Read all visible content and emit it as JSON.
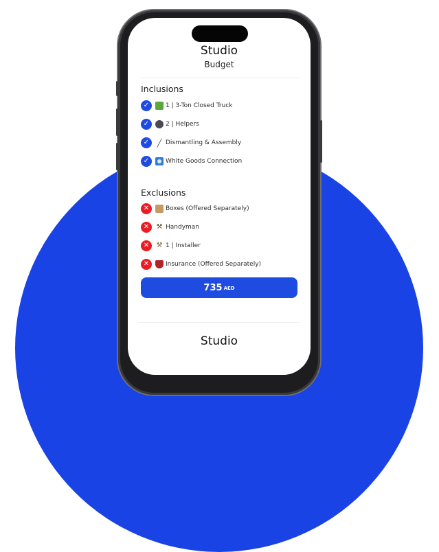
{
  "card": {
    "title": "Studio",
    "subtitle": "Budget",
    "inclusions_heading": "Inclusions",
    "inclusions": [
      {
        "label": "1 | 3-Ton Closed Truck",
        "icon": "truck-icon"
      },
      {
        "label": "2 | Helpers",
        "icon": "helpers-icon"
      },
      {
        "label": "Dismantling & Assembly",
        "icon": "screwdriver-icon"
      },
      {
        "label": "White Goods Connection",
        "icon": "washing-machine-icon"
      }
    ],
    "exclusions_heading": "Exclusions",
    "exclusions": [
      {
        "label": "Boxes (Offered Separately)",
        "icon": "box-icon"
      },
      {
        "label": "Handyman",
        "icon": "hammer-icon"
      },
      {
        "label": "1 | Installer",
        "icon": "tools-icon"
      },
      {
        "label": "Insurance (Offered Separately)",
        "icon": "shield-icon"
      }
    ],
    "price_amount": "735",
    "price_currency": "AED"
  },
  "next_card": {
    "title": "Studio"
  },
  "colors": {
    "accent": "#1f4ce0",
    "background_circle": "#1a43e6",
    "excluded": "#ec1c24"
  }
}
